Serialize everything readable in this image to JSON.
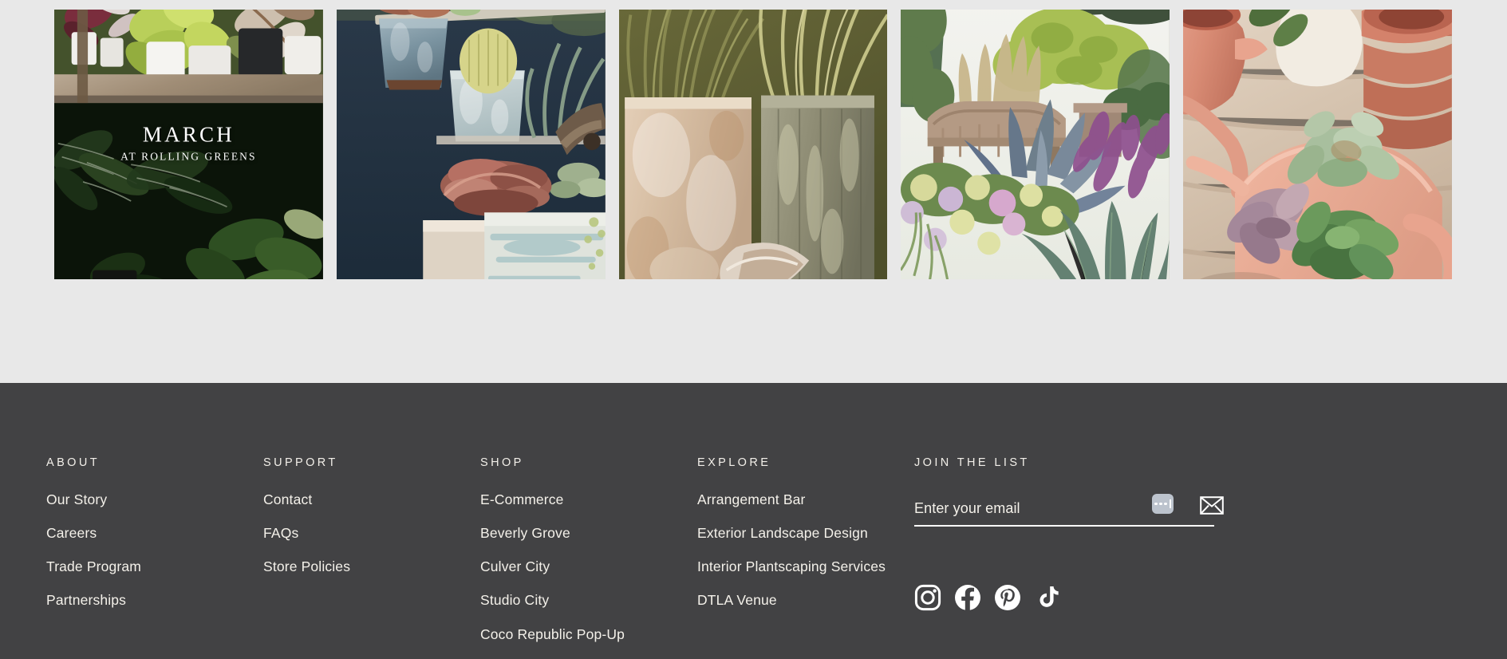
{
  "gallery": {
    "tiles": [
      {
        "name": "nursery-shelves-houseplants",
        "caption_main": "MARCH",
        "caption_sub": "AT ROLLING GREENS",
        "has_caption": true
      },
      {
        "name": "ceramic-pots-cacti-succulents",
        "caption_main": "",
        "caption_sub": "",
        "has_caption": false
      },
      {
        "name": "weathered-terracotta-planters",
        "caption_main": "",
        "caption_sub": "",
        "has_caption": false
      },
      {
        "name": "garden-landscape-hydrangeas-agave",
        "caption_main": "",
        "caption_sub": "",
        "has_caption": false
      },
      {
        "name": "pink-watering-can-succulents",
        "caption_main": "",
        "caption_sub": "",
        "has_caption": false
      }
    ]
  },
  "footer": {
    "columns": [
      {
        "heading": "ABOUT",
        "links": [
          "Our Story",
          "Careers",
          "Trade Program",
          "Partnerships"
        ]
      },
      {
        "heading": "SUPPORT",
        "links": [
          "Contact",
          "FAQs",
          "Store Policies"
        ]
      },
      {
        "heading": "SHOP",
        "links": [
          "E-Commerce",
          "Beverly Grove",
          "Culver City",
          "Studio City",
          "Coco Republic Pop-Up"
        ]
      },
      {
        "heading": "EXPLORE",
        "links": [
          "Arrangement Bar",
          "Exterior Landscape Design",
          "Interior Plantscaping Services",
          "DTLA Venue"
        ]
      }
    ],
    "newsletter": {
      "heading": "JOIN THE LIST",
      "placeholder": "Enter your email",
      "value": "",
      "ime_indicator": "ime-dots-indicator",
      "submit_icon": "envelope-icon"
    },
    "social": [
      {
        "name": "instagram",
        "label": "Instagram"
      },
      {
        "name": "facebook",
        "label": "Facebook"
      },
      {
        "name": "pinterest",
        "label": "Pinterest"
      },
      {
        "name": "tiktok",
        "label": "TikTok"
      }
    ]
  },
  "colors": {
    "page_background": "#e8e8e8",
    "footer_background": "#424244",
    "footer_text": "#f4f1ea",
    "accent_underline": "#ffffff",
    "ime_chip": "#bcc3cd"
  }
}
